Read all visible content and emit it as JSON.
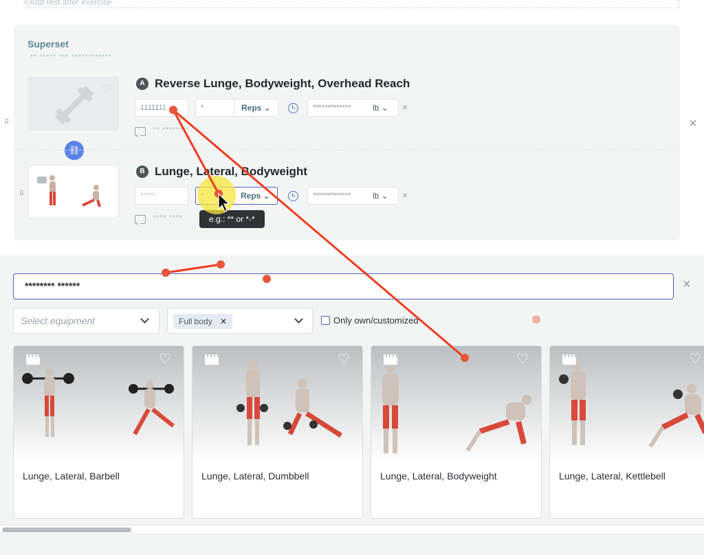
{
  "top_row": {
    "label": "+ Add rest after exercise"
  },
  "superset": {
    "title": "Superset",
    "subtitle": "** ***** *** ************",
    "exercises": [
      {
        "letter": "A",
        "name": "Reverse Lunge, Bodyweight, Overhead Reach",
        "sets_value": "1111111",
        "reps_value": "*",
        "reps_unit": "Reps",
        "weight_value": "*************",
        "weight_unit": "lb",
        "note": "** ********"
      },
      {
        "letter": "B",
        "name": "Lunge, Lateral, Bodyweight",
        "sets_value": "*****",
        "reps_value": "*",
        "reps_unit": "Reps",
        "weight_value": "*************",
        "weight_unit": "lb",
        "note": "**** ****"
      }
    ],
    "tooltip": "e.g.: ** or *-*",
    "link_icon": "link-icon"
  },
  "library": {
    "search_value": "******** ******",
    "equipment_placeholder": "Select equipment",
    "body_chip": "Full body",
    "only_own_label": "Only own/customized",
    "cards": [
      {
        "name": "Lunge, Lateral, Barbell"
      },
      {
        "name": "Lunge, Lateral, Dumbbell"
      },
      {
        "name": "Lunge, Lateral, Bodyweight"
      },
      {
        "name": "Lunge, Lateral, Kettlebell"
      }
    ]
  },
  "colors": {
    "accent": "#4a5fc1",
    "annotation": "#ee3b1f",
    "superset_title": "#5f8797"
  }
}
